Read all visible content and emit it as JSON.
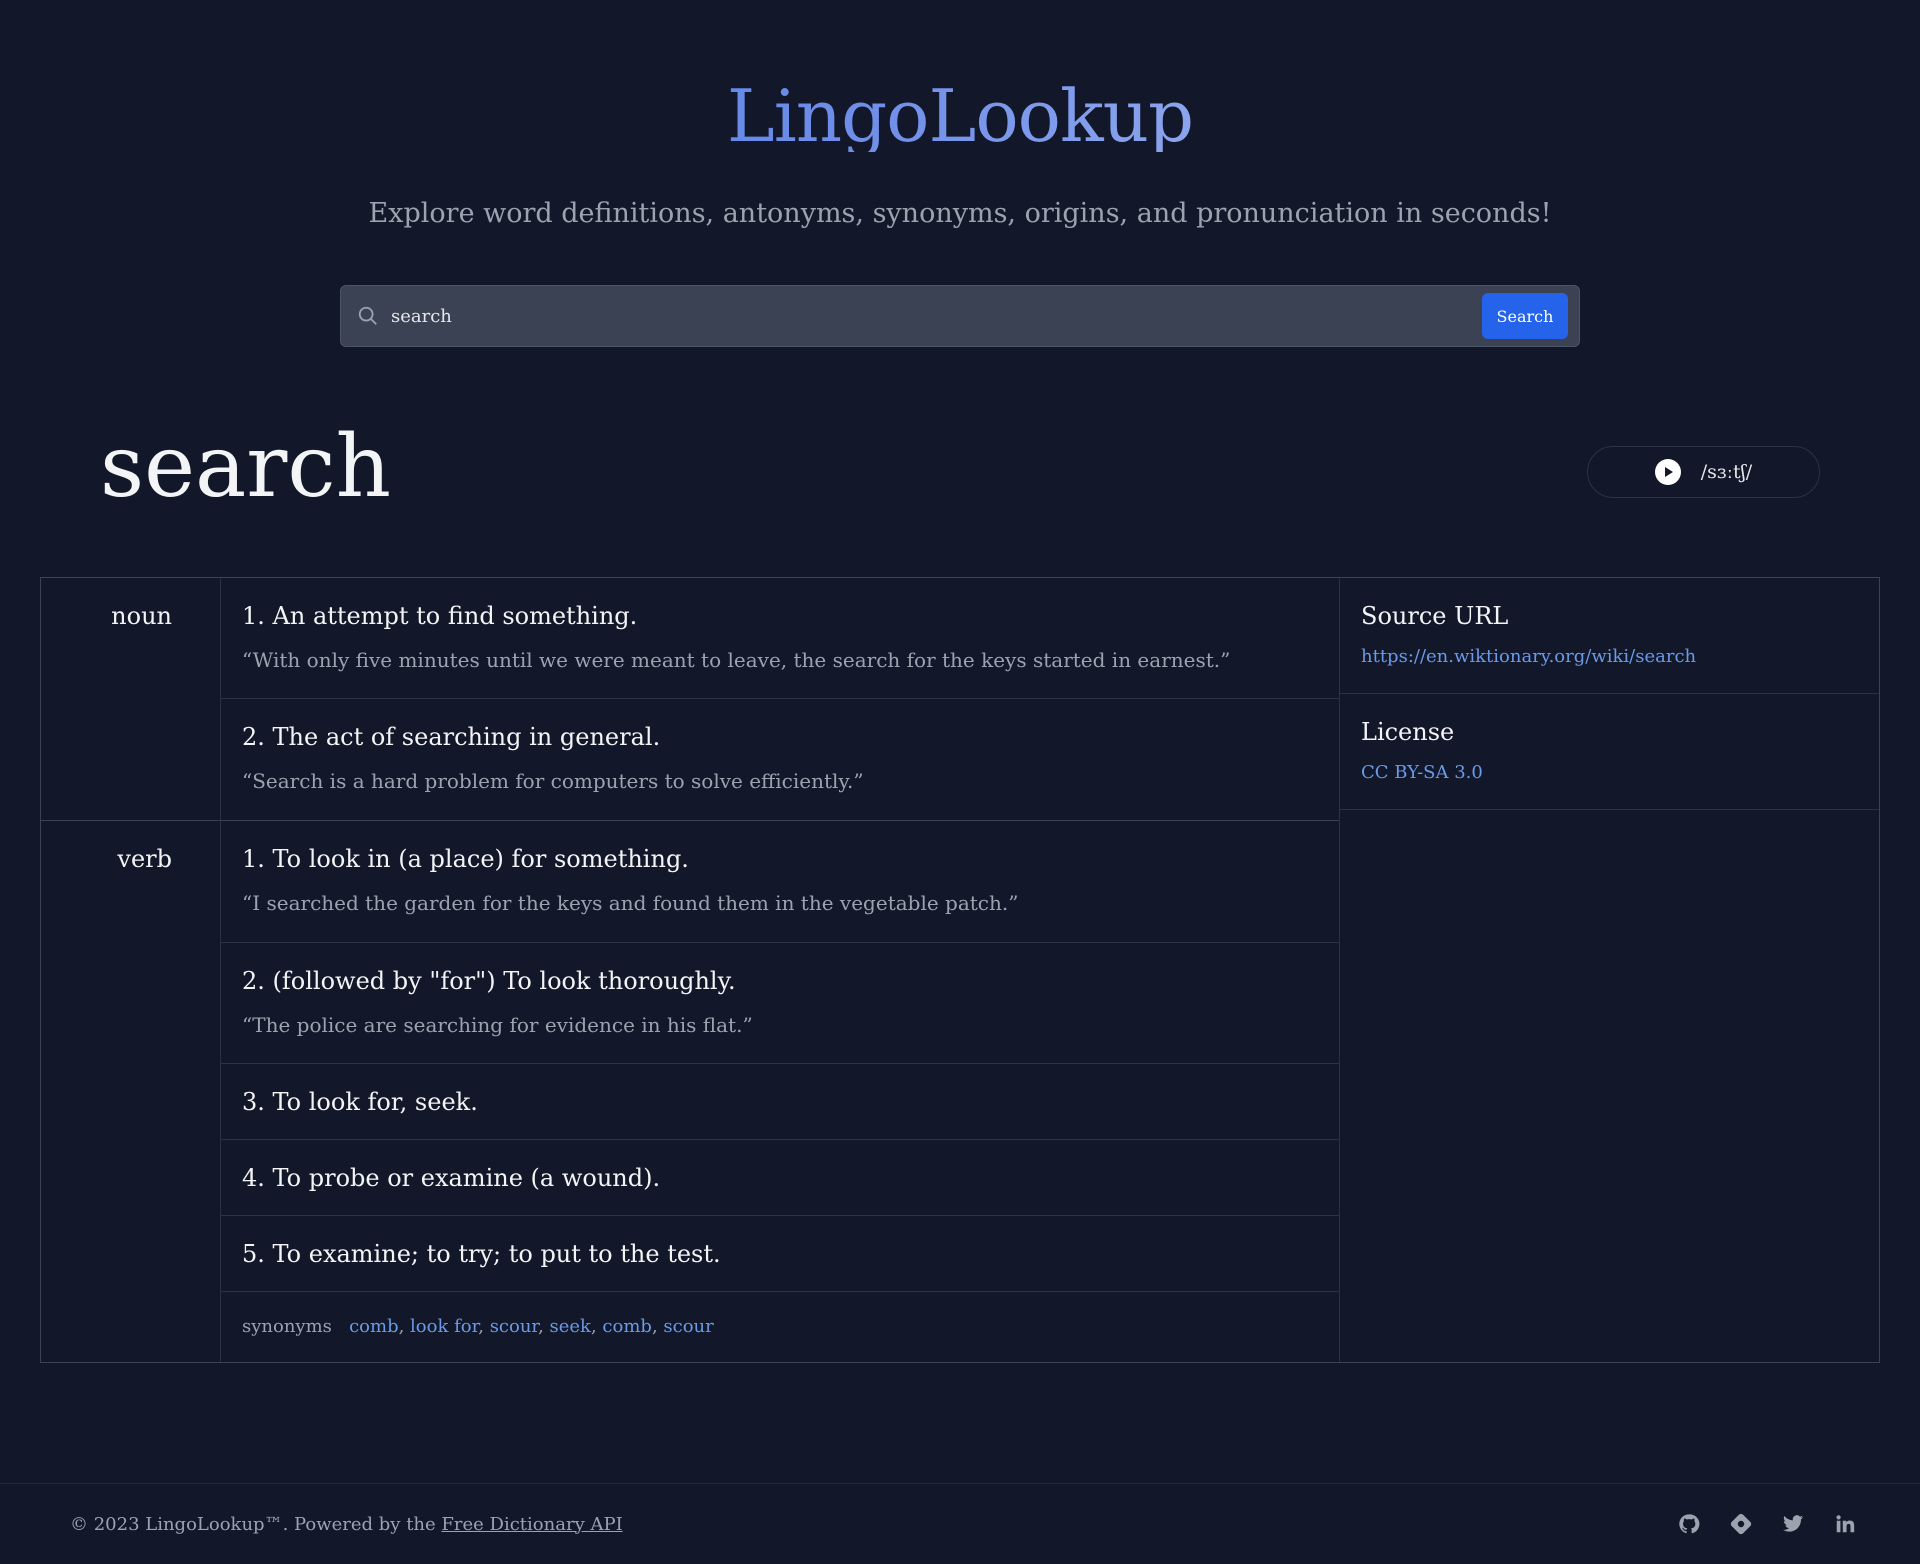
{
  "app": {
    "logo": "LingoLookup",
    "tagline": "Explore word definitions, antonyms, synonyms, origins, and pronunciation in seconds!"
  },
  "search": {
    "value": "search",
    "button_label": "Search"
  },
  "entry": {
    "word": "search",
    "phonetic": "/sɜːtʃ/"
  },
  "meanings": [
    {
      "pos": "noun",
      "definitions": [
        {
          "text": "1. An attempt to find something.",
          "example": "“With only five minutes until we were meant to leave, the search for the keys started in earnest.”"
        },
        {
          "text": "2. The act of searching in general.",
          "example": "“Search is a hard problem for computers to solve efficiently.”"
        }
      ]
    },
    {
      "pos": "verb",
      "definitions": [
        {
          "text": "1. To look in (a place) for something.",
          "example": "“I searched the garden for the keys and found them in the vegetable patch.”"
        },
        {
          "text": "2. (followed by \"for\") To look thoroughly.",
          "example": "“The police are searching for evidence in his flat.”"
        },
        {
          "text": "3. To look for, seek.",
          "example": ""
        },
        {
          "text": "4. To probe or examine (a wound).",
          "example": ""
        },
        {
          "text": "5. To examine; to try; to put to the test.",
          "example": ""
        }
      ],
      "synonyms_label": "synonyms",
      "synonyms": [
        "comb",
        "look for",
        "scour",
        "seek",
        "comb",
        "scour"
      ]
    }
  ],
  "sidebar": {
    "source_title": "Source URL",
    "source_url": "https://en.wiktionary.org/wiki/search",
    "license_title": "License",
    "license": "CC BY-SA 3.0"
  },
  "footer": {
    "copyright": "© 2023 LingoLookup™. Powered by the",
    "api_link": "Free Dictionary API",
    "icons": [
      "github-icon",
      "hashnode-icon",
      "twitter-icon",
      "linkedin-icon"
    ]
  },
  "colors": {
    "background": "#121829",
    "accent": "#2563eb",
    "link": "#6b9ae8"
  }
}
